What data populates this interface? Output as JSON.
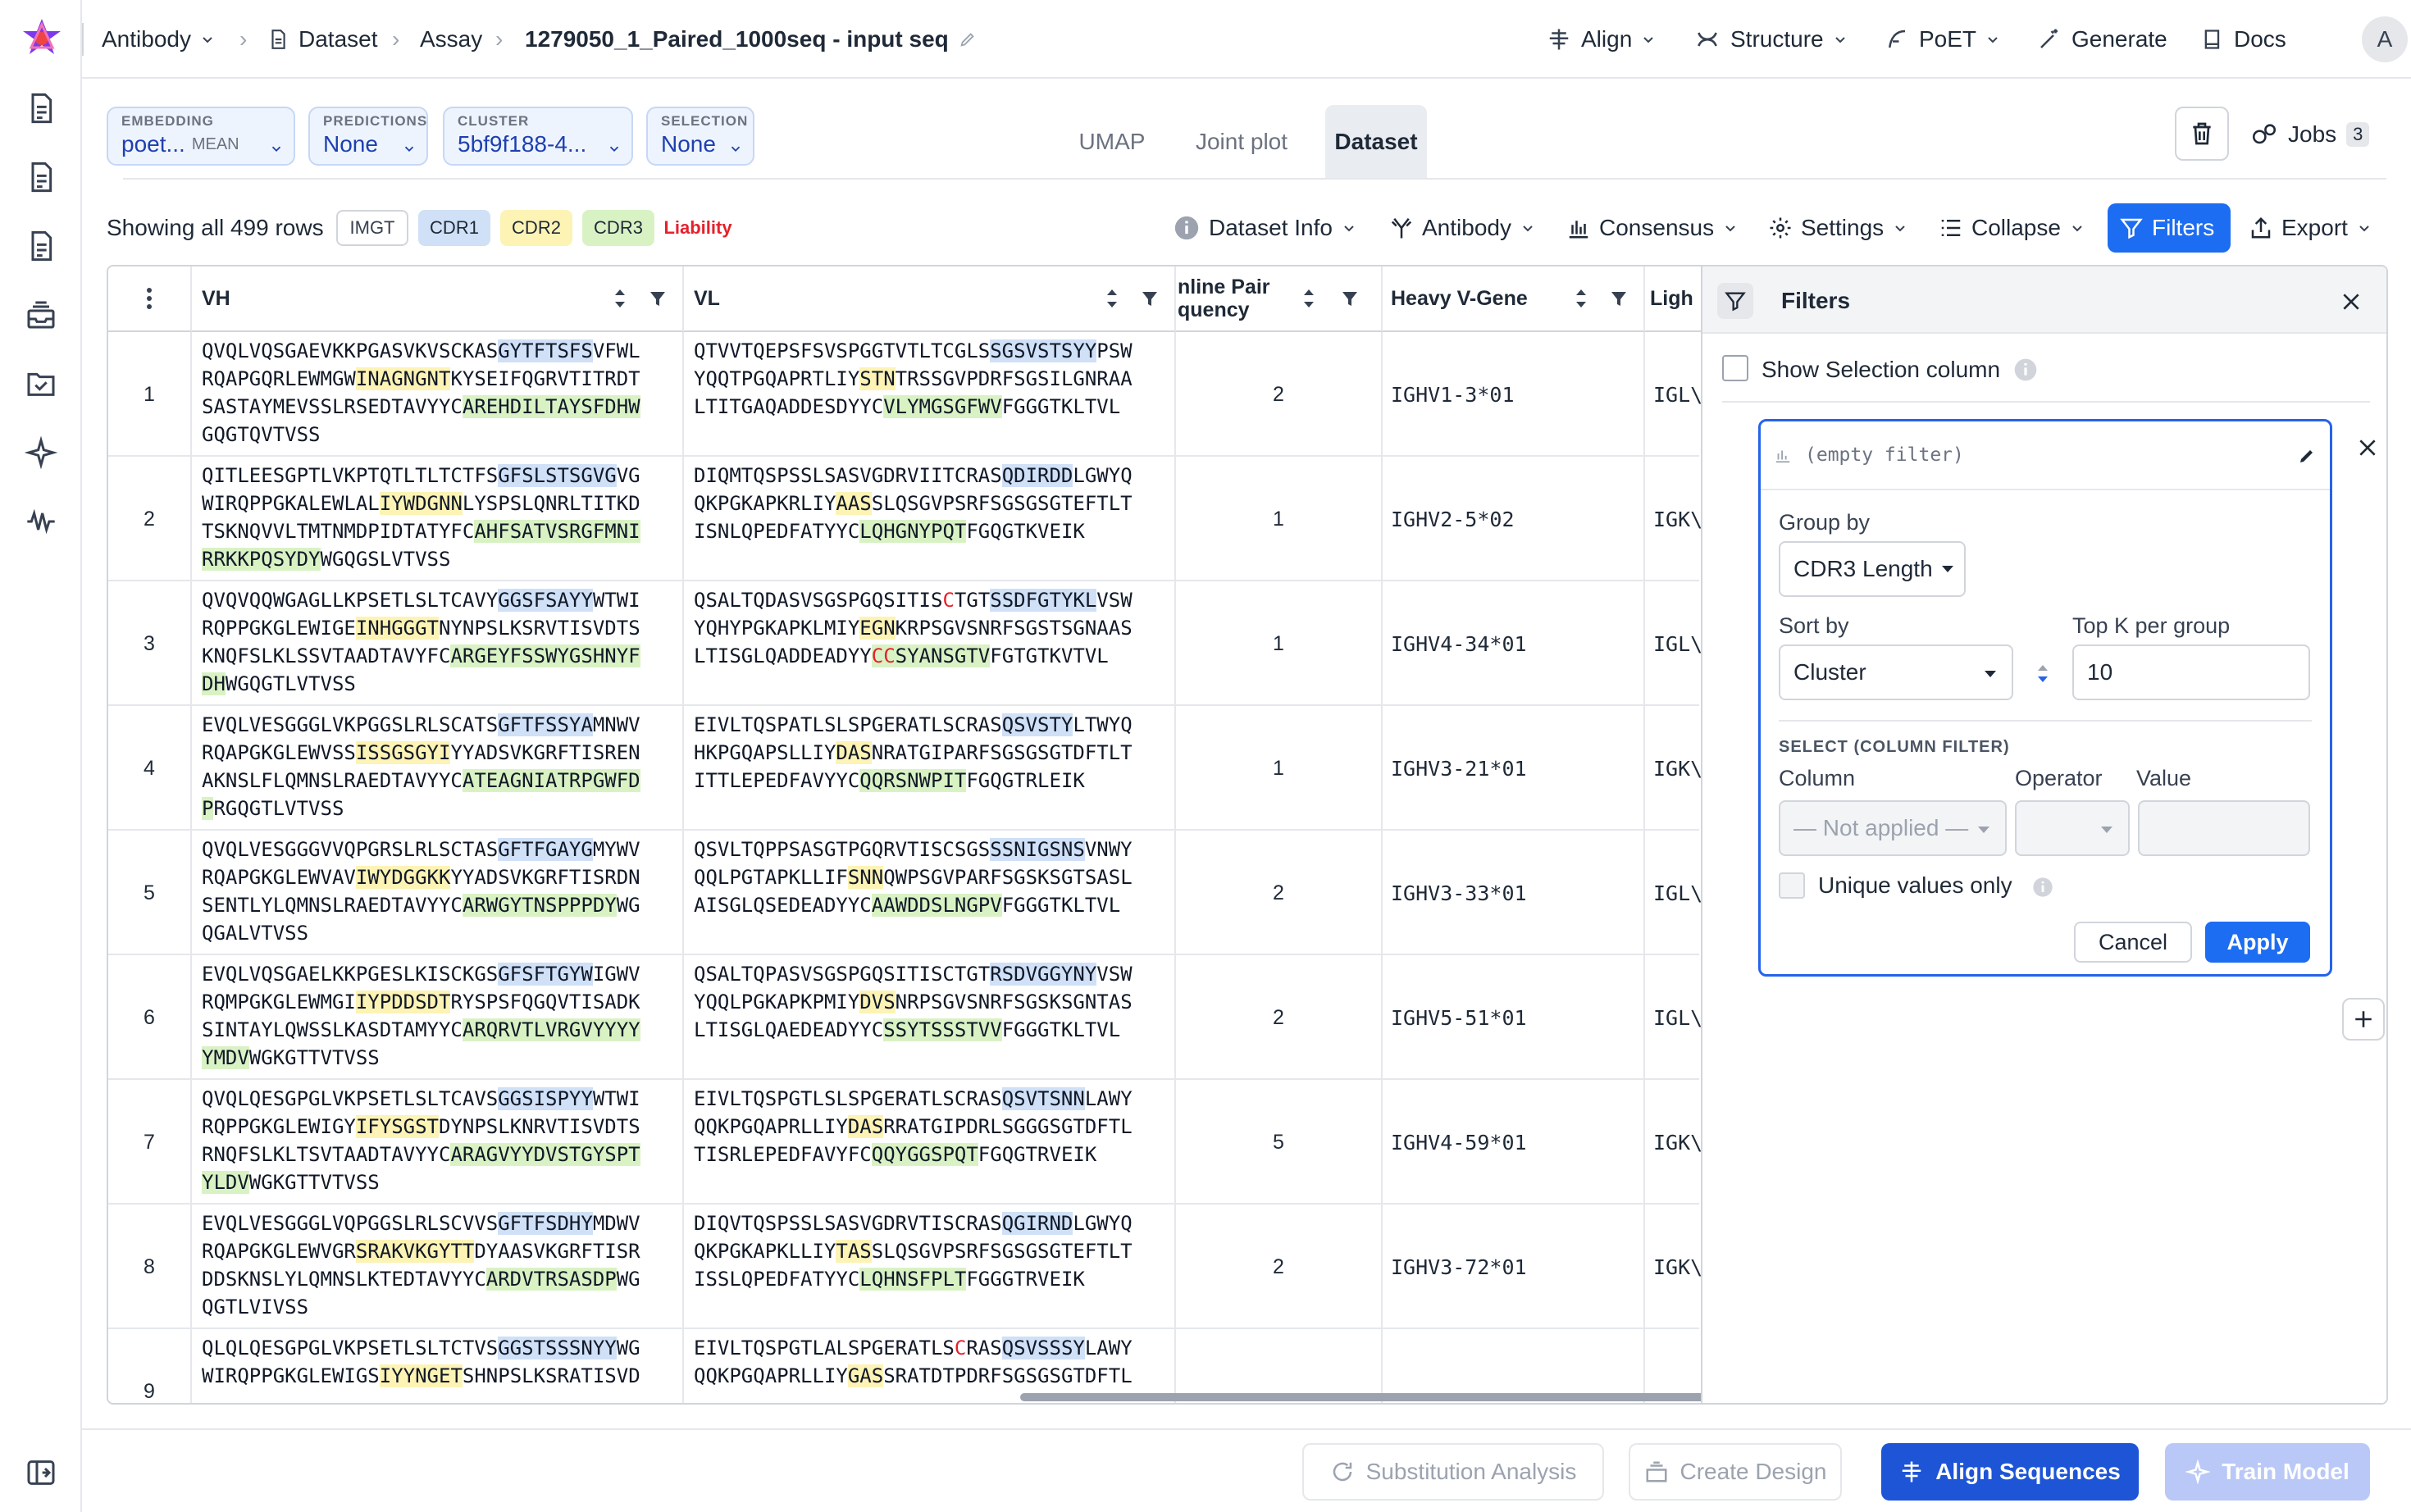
{
  "topbar": {
    "breadcrumb": [
      "Antibody",
      "Dataset",
      "Assay",
      "1279050_1_Paired_1000seq - input seq"
    ],
    "nav": [
      "Align",
      "Structure",
      "PoET",
      "Generate",
      "Docs"
    ],
    "avatar": "A"
  },
  "controls": {
    "embedding": {
      "label": "EMBEDDING",
      "value": "poet...",
      "sub": "MEAN"
    },
    "predictions": {
      "label": "PREDICTIONS",
      "value": "None"
    },
    "cluster": {
      "label": "CLUSTER",
      "value": "5bf9f188-4..."
    },
    "selection": {
      "label": "SELECTION",
      "value": "None"
    }
  },
  "tabs": [
    "UMAP",
    "Joint plot",
    "Dataset"
  ],
  "jobs": {
    "label": "Jobs",
    "count": "3"
  },
  "toolbar": {
    "rows_text": "Showing all 499 rows",
    "tags": [
      "IMGT",
      "CDR1",
      "CDR2",
      "CDR3",
      "Liability"
    ],
    "buttons": [
      "Dataset Info",
      "Antibody",
      "Consensus",
      "Settings",
      "Collapse",
      "Filters",
      "Export"
    ]
  },
  "table": {
    "headers": [
      "VH",
      "VL",
      "nline Pair\nquency",
      "Heavy V-Gene",
      "Ligh"
    ],
    "rows": [
      {
        "idx": "1",
        "count": "2",
        "gene": "IGHV1-3*01",
        "light": "IGL\\",
        "vh": [
          [
            [
              "QVQLVQSGAEVKKPGASVKVSCKAS",
              ""
            ],
            [
              "GYTFTSFS",
              "c1"
            ],
            [
              "VFWL",
              ""
            ]
          ],
          [
            [
              "RQAPGQRLEWMGW",
              ""
            ],
            [
              "INAGNGNT",
              "c2"
            ],
            [
              "KYSEIFQGRVTITRDT",
              ""
            ]
          ],
          [
            [
              "SASTAYMEVSSLRSEDTAVYYC",
              ""
            ],
            [
              "AREHDILTAYSFDHW",
              "c3"
            ]
          ],
          [
            [
              "GQGTQVTVSS",
              ""
            ]
          ]
        ],
        "vl": [
          [
            [
              "QTVVTQEPSFSVSPGGTVTLTCGLS",
              ""
            ],
            [
              "SGSVSTSYY",
              "c1"
            ],
            [
              "PSW",
              ""
            ]
          ],
          [
            [
              "YQQTPGQAPRTLIY",
              ""
            ],
            [
              "STN",
              "c2"
            ],
            [
              "TRSSGVPDRFSGSILGNRAA",
              ""
            ]
          ],
          [
            [
              "LTITGAQADDESDYYC",
              ""
            ],
            [
              "VLYMGSGFWV",
              "c3"
            ],
            [
              "FGGGTKLTVL",
              ""
            ]
          ]
        ]
      },
      {
        "idx": "2",
        "count": "1",
        "gene": "IGHV2-5*02",
        "light": "IGK\\",
        "vh": [
          [
            [
              "QITLEESGPTLVKPTQTLTLTCTFS",
              ""
            ],
            [
              "GFSLSTSGVG",
              "c1"
            ],
            [
              "VG",
              ""
            ]
          ],
          [
            [
              "WIRQPPGKALEWLAL",
              ""
            ],
            [
              "IYWDGNN",
              "c2"
            ],
            [
              "LYSPSLQNRLTITKD",
              ""
            ]
          ],
          [
            [
              "TSKNQVVLTMTNMDPIDTATYFC",
              ""
            ],
            [
              "AHFSATVSRGFMNI",
              "c3"
            ]
          ],
          [
            [
              "RRKKPQSYDY",
              "c3"
            ],
            [
              "WGQGSLVTVSS",
              ""
            ]
          ]
        ],
        "vl": [
          [
            [
              "DIQMTQSPSSLSASVGDRVIITCRAS",
              ""
            ],
            [
              "QDIRDD",
              "c1"
            ],
            [
              "LGWYQ",
              ""
            ]
          ],
          [
            [
              "QKPGKAPKRLIY",
              ""
            ],
            [
              "AAS",
              "c2"
            ],
            [
              "SLQSGVPSRFSGSGSGTEFTLT",
              ""
            ]
          ],
          [
            [
              "ISNLQPEDFATYYC",
              ""
            ],
            [
              "LQHGNYPQT",
              "c3"
            ],
            [
              "FGQGTKVEIK",
              ""
            ]
          ]
        ]
      },
      {
        "idx": "3",
        "count": "1",
        "gene": "IGHV4-34*01",
        "light": "IGL\\",
        "vh": [
          [
            [
              "QVQVQQWGAGLLKPSETLSLTCAVY",
              ""
            ],
            [
              "GGSFSAYY",
              "c1"
            ],
            [
              "WTWI",
              ""
            ]
          ],
          [
            [
              "RQPPGKGLEWIGE",
              ""
            ],
            [
              "INHGGGT",
              "c2"
            ],
            [
              "NYNPSLKSRVTISVDTS",
              ""
            ]
          ],
          [
            [
              "KNQFSLKLSSVTAADTAVYFC",
              ""
            ],
            [
              "ARGEYFSSWYGSHNYF",
              "c3"
            ]
          ],
          [
            [
              "DH",
              "c3"
            ],
            [
              "WGQGTLVTVSS",
              ""
            ]
          ]
        ],
        "vl": [
          [
            [
              "QSALTQDASVSGSPGQSITIS",
              ""
            ],
            [
              "C",
              "lb"
            ],
            [
              "TGT",
              ""
            ],
            [
              "SSDFGTYKL",
              "c1"
            ],
            [
              "VSW",
              ""
            ]
          ],
          [
            [
              "YQHYPGKAPKLMIY",
              ""
            ],
            [
              "EGN",
              "c2"
            ],
            [
              "KRPSGVSNRFSGSTSGNAAS",
              ""
            ]
          ],
          [
            [
              "LTISGLQADDEADYY",
              ""
            ],
            [
              "CC",
              "lb c3"
            ],
            [
              "SYANSGTV",
              "c3"
            ],
            [
              "FGTGTKVTVL",
              ""
            ]
          ]
        ]
      },
      {
        "idx": "4",
        "count": "1",
        "gene": "IGHV3-21*01",
        "light": "IGK\\",
        "vh": [
          [
            [
              "EVQLVESGGGLVKPGGSLRLSCATS",
              ""
            ],
            [
              "GFTFSSYA",
              "c1"
            ],
            [
              "MNWV",
              ""
            ]
          ],
          [
            [
              "RQAPGKGLEWVSS",
              ""
            ],
            [
              "ISSGSGYI",
              "c2"
            ],
            [
              "YYADSVKGRFTISREN",
              ""
            ]
          ],
          [
            [
              "AKNSLFLQMNSLRAEDTAVYYC",
              ""
            ],
            [
              "ATEAGNIATRPGWFD",
              "c3"
            ]
          ],
          [
            [
              "P",
              "c3"
            ],
            [
              "RGQGTLVTVSS",
              ""
            ]
          ]
        ],
        "vl": [
          [
            [
              "EIVLTQSPATLSLSPGERATLSCRAS",
              ""
            ],
            [
              "QSVSTY",
              "c1"
            ],
            [
              "LTWYQ",
              ""
            ]
          ],
          [
            [
              "HKPGQAPSLLIY",
              ""
            ],
            [
              "DAS",
              "c2"
            ],
            [
              "NRATGIPARFSGSGSGTDFTLT",
              ""
            ]
          ],
          [
            [
              "ITTLEPEDFAVYYC",
              ""
            ],
            [
              "QQRSNWPIT",
              "c3"
            ],
            [
              "FGQGTRLEIK",
              ""
            ]
          ]
        ]
      },
      {
        "idx": "5",
        "count": "2",
        "gene": "IGHV3-33*01",
        "light": "IGL\\",
        "vh": [
          [
            [
              "QVQLVESGGGVVQPGRSLRLSCTAS",
              ""
            ],
            [
              "GFTFGAYG",
              "c1"
            ],
            [
              "MYWV",
              ""
            ]
          ],
          [
            [
              "RQAPGKGLEWVAV",
              ""
            ],
            [
              "IWYDGGKK",
              "c2"
            ],
            [
              "YYADSVKGRFTISRDN",
              ""
            ]
          ],
          [
            [
              "SENTLYLQMNSLRAEDTAVYYC",
              ""
            ],
            [
              "ARWGYTNSPPPDY",
              "c3"
            ],
            [
              "WG",
              ""
            ]
          ],
          [
            [
              "QGALVTVSS",
              ""
            ]
          ]
        ],
        "vl": [
          [
            [
              "QSVLTQPPSASGTPGQRVTISCSGS",
              ""
            ],
            [
              "SSNIGSNS",
              "c1"
            ],
            [
              "VNWY",
              ""
            ]
          ],
          [
            [
              "QQLPGTAPKLLIF",
              ""
            ],
            [
              "SNN",
              "c2"
            ],
            [
              "QWPSGVPARFSGSKSGTSASL",
              ""
            ]
          ],
          [
            [
              "AISGLQSEDEADYYC",
              ""
            ],
            [
              "AAWDDSLNGPV",
              "c3"
            ],
            [
              "FGGGTKLTVL",
              ""
            ]
          ]
        ]
      },
      {
        "idx": "6",
        "count": "2",
        "gene": "IGHV5-51*01",
        "light": "IGL\\",
        "vh": [
          [
            [
              "EVQLVQSGAELKKPGESLKISCKGS",
              ""
            ],
            [
              "GFSFTGYW",
              "c1"
            ],
            [
              "IGWV",
              ""
            ]
          ],
          [
            [
              "RQMPGKGLEWMGI",
              ""
            ],
            [
              "IYPDDSDT",
              "c2"
            ],
            [
              "RYSPSFQGQVTISADK",
              ""
            ]
          ],
          [
            [
              "SINTAYLQWSSLKASDTAMYYC",
              ""
            ],
            [
              "ARQRVTLVRGVYYYY",
              "c3"
            ]
          ],
          [
            [
              "YMDV",
              "c3"
            ],
            [
              "WGKGTTVTVSS",
              ""
            ]
          ]
        ],
        "vl": [
          [
            [
              "QSALTQPASVSGSPGQSITISCTGT",
              ""
            ],
            [
              "RSDVGGYNY",
              "c1"
            ],
            [
              "VSW",
              ""
            ]
          ],
          [
            [
              "YQQLPGKAPKPMIY",
              ""
            ],
            [
              "DVS",
              "c2"
            ],
            [
              "NRPSGVSNRFSGSKSGNTAS",
              ""
            ]
          ],
          [
            [
              "LTISGLQAEDEADYYC",
              ""
            ],
            [
              "SSYTSSSTVV",
              "c3"
            ],
            [
              "FGGGTKLTVL",
              ""
            ]
          ]
        ]
      },
      {
        "idx": "7",
        "count": "5",
        "gene": "IGHV4-59*01",
        "light": "IGK\\",
        "vh": [
          [
            [
              "QVQLQESGPGLVKPSETLSLTCAVS",
              ""
            ],
            [
              "GGSISPYY",
              "c1"
            ],
            [
              "WTWI",
              ""
            ]
          ],
          [
            [
              "RQPPGKGLEWIGY",
              ""
            ],
            [
              "IFYSGST",
              "c2"
            ],
            [
              "DYNPSLKNRVTISVDTS",
              ""
            ]
          ],
          [
            [
              "RNQFSLKLTSVTAADTAVYYC",
              ""
            ],
            [
              "ARAGVYYDVSTGYSPT",
              "c3"
            ]
          ],
          [
            [
              "YLDV",
              "c3"
            ],
            [
              "WGKGTTVTVSS",
              ""
            ]
          ]
        ],
        "vl": [
          [
            [
              "EIVLTQSPGTLSLSPGERATLSCRAS",
              ""
            ],
            [
              "QSVTSNN",
              "c1"
            ],
            [
              "LAWY",
              ""
            ]
          ],
          [
            [
              "QQKPGQAPRLLIY",
              ""
            ],
            [
              "DAS",
              "c2"
            ],
            [
              "RRATGIPDRLSGGGSGTDFTL",
              ""
            ]
          ],
          [
            [
              "TISRLEPEDFAVYFC",
              ""
            ],
            [
              "QQYGGSPQT",
              "c3"
            ],
            [
              "FGQGTRVEIK",
              ""
            ]
          ]
        ]
      },
      {
        "idx": "8",
        "count": "2",
        "gene": "IGHV3-72*01",
        "light": "IGK\\",
        "vh": [
          [
            [
              "EVQLVESGGGLVQPGGSLRLSCVVS",
              ""
            ],
            [
              "GFTFSDHY",
              "c1"
            ],
            [
              "MDWV",
              ""
            ]
          ],
          [
            [
              "RQAPGKGLEWVGR",
              ""
            ],
            [
              "SRAKVKGYTT",
              "c2"
            ],
            [
              "DYAASVKGRFTISR",
              ""
            ]
          ],
          [
            [
              "DDSKNSLYLQMNSLKTEDTAVYYC",
              ""
            ],
            [
              "ARDVTRSASDP",
              "c3"
            ],
            [
              "WG",
              ""
            ]
          ],
          [
            [
              "QGTLVIVSS",
              ""
            ]
          ]
        ],
        "vl": [
          [
            [
              "DIQVTQSPSSLSASVGDRVTISCRAS",
              ""
            ],
            [
              "QGIRND",
              "c1"
            ],
            [
              "LGWYQ",
              ""
            ]
          ],
          [
            [
              "QKPGKAPKLLIY",
              ""
            ],
            [
              "TAS",
              "c2"
            ],
            [
              "SLQSGVPSRFSGSGSGTEFTLT",
              ""
            ]
          ],
          [
            [
              "ISSLQPEDFATYYC",
              ""
            ],
            [
              "LQHNSFPLT",
              "c3"
            ],
            [
              "FGGGTRVEIK",
              ""
            ]
          ]
        ]
      },
      {
        "idx": "9",
        "count": "",
        "gene": "",
        "light": "",
        "vh": [
          [
            [
              "QLQLQESGPGLVKPSETLSLTCTVS",
              ""
            ],
            [
              "GGSTSSSNYY",
              "c1"
            ],
            [
              "WG",
              ""
            ]
          ],
          [
            [
              "WIRQPPGKGLEWIGS",
              ""
            ],
            [
              "IYYNGET",
              "c2"
            ],
            [
              "SHNPSLKSRATISVD",
              ""
            ]
          ]
        ],
        "vl": [
          [
            [
              "EIVLTQSPGTLALSPGERATLS",
              ""
            ],
            [
              "C",
              "lb"
            ],
            [
              "RAS",
              ""
            ],
            [
              "QSVSSSY",
              "c1"
            ],
            [
              "LAWY",
              ""
            ]
          ],
          [
            [
              "QQKPGQAPRLLIY",
              ""
            ],
            [
              "GAS",
              "c2"
            ],
            [
              "SRATDTPDRFSGSGSGTDFTL",
              ""
            ]
          ]
        ]
      }
    ]
  },
  "filters_panel": {
    "title": "Filters",
    "show_selection": "Show Selection column",
    "empty_filter": "(empty filter)",
    "group_by_label": "Group by",
    "group_by_value": "CDR3 Length",
    "sort_by_label": "Sort by",
    "sort_by_value": "Cluster",
    "topk_label": "Top K per group",
    "topk_value": "10",
    "select_title": "SELECT (COLUMN FILTER)",
    "column_label": "Column",
    "operator_label": "Operator",
    "value_label": "Value",
    "column_value": "— Not applied —",
    "unique_label": "Unique values only",
    "cancel": "Cancel",
    "apply": "Apply"
  },
  "bottom": {
    "substitution": "Substitution Analysis",
    "create_design": "Create Design",
    "align": "Align Sequences",
    "train": "Train Model"
  },
  "colors": {
    "accent": "#1d6df2",
    "cdr1": "#cfe0f7",
    "cdr2": "#fdf3b4",
    "cdr3": "#d9f2c4",
    "liability": "#e5212b"
  }
}
